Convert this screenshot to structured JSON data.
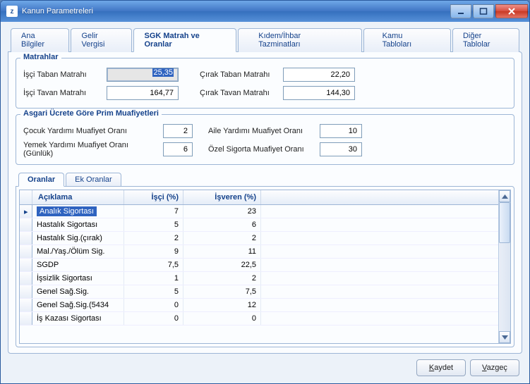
{
  "window": {
    "title": "Kanun Parametreleri"
  },
  "tabs": [
    "Ana Bilgiler",
    "Gelir Vergisi",
    "SGK Matrah ve Oranlar",
    "Kıdem/İhbar Tazminatları",
    "Kamu Tabloları",
    "Diğer Tablolar"
  ],
  "activeTab": 2,
  "matrahlar": {
    "legend": "Matrahlar",
    "isciTabanLbl": "İşçi Taban Matrahı",
    "isciTabanVal": "25,35",
    "isciTavanLbl": "İşçi Tavan Matrahı",
    "isciTavanVal": "164,77",
    "cirakTabanLbl": "Çırak Taban Matrahı",
    "cirakTabanVal": "22,20",
    "cirakTavanLbl": "Çırak Tavan Matrahı",
    "cirakTavanVal": "144,30"
  },
  "muafiyet": {
    "legend": "Asgari Ücrete Göre Prim Muafiyetleri",
    "cocukLbl": "Çocuk Yardımı Muafiyet Oranı",
    "cocukVal": "2",
    "yemekLbl": "Yemek Yardımı Muafiyet Oranı (Günlük)",
    "yemekVal": "6",
    "aileLbl": "Aile Yardımı Muafiyet Oranı",
    "aileVal": "10",
    "ozelLbl": "Özel Sigorta Muafiyet Oranı",
    "ozelVal": "30"
  },
  "subTabs": [
    "Oranlar",
    "Ek Oranlar"
  ],
  "activeSubTab": 0,
  "grid": {
    "cols": [
      "Açıklama",
      "İşçi (%)",
      "İşveren (%)"
    ],
    "rows": [
      {
        "aciklama": "Analık Sigortası",
        "isci": "7",
        "isveren": "23"
      },
      {
        "aciklama": "Hastalık Sigortası",
        "isci": "5",
        "isveren": "6"
      },
      {
        "aciklama": "Hastalık Sig.(çırak)",
        "isci": "2",
        "isveren": "2"
      },
      {
        "aciklama": "Mal./Yaş./Ölüm Sig.",
        "isci": "9",
        "isveren": "11"
      },
      {
        "aciklama": "SGDP",
        "isci": "7,5",
        "isveren": "22,5"
      },
      {
        "aciklama": "İşsizlik Sigortası",
        "isci": "1",
        "isveren": "2"
      },
      {
        "aciklama": "Genel Sağ.Sig.",
        "isci": "5",
        "isveren": "7,5"
      },
      {
        "aciklama": "Genel Sağ.Sig.(5434",
        "isci": "0",
        "isveren": "12"
      },
      {
        "aciklama": "İş Kazası Sigortası",
        "isci": "0",
        "isveren": "0"
      }
    ],
    "selectedRow": 0
  },
  "buttons": {
    "save": "Kaydet",
    "cancel": "Vazgeç"
  }
}
